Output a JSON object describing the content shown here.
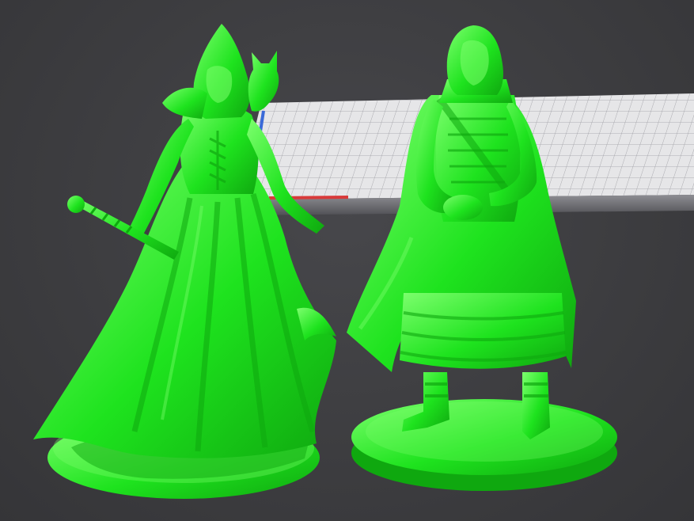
{
  "viewport": {
    "background_color": "#3c3c3f"
  },
  "build_plate": {
    "surface_color": "#e6e6e8",
    "grid_color": "#9a9aa0",
    "edge_color": "#5f5f64",
    "axis_x_color": "#d83a3a",
    "axis_y_color": "#3a6ad8"
  },
  "models": [
    {
      "id": "hooded-sorceress-miniature",
      "color": "#1ee31e",
      "shade_color": "#0fa80f",
      "highlight_color": "#7dff6e",
      "selected": true
    },
    {
      "id": "adventurer-woman-miniature",
      "color": "#1ee31e",
      "shade_color": "#0fa80f",
      "highlight_color": "#7dff6e",
      "selected": true
    }
  ]
}
